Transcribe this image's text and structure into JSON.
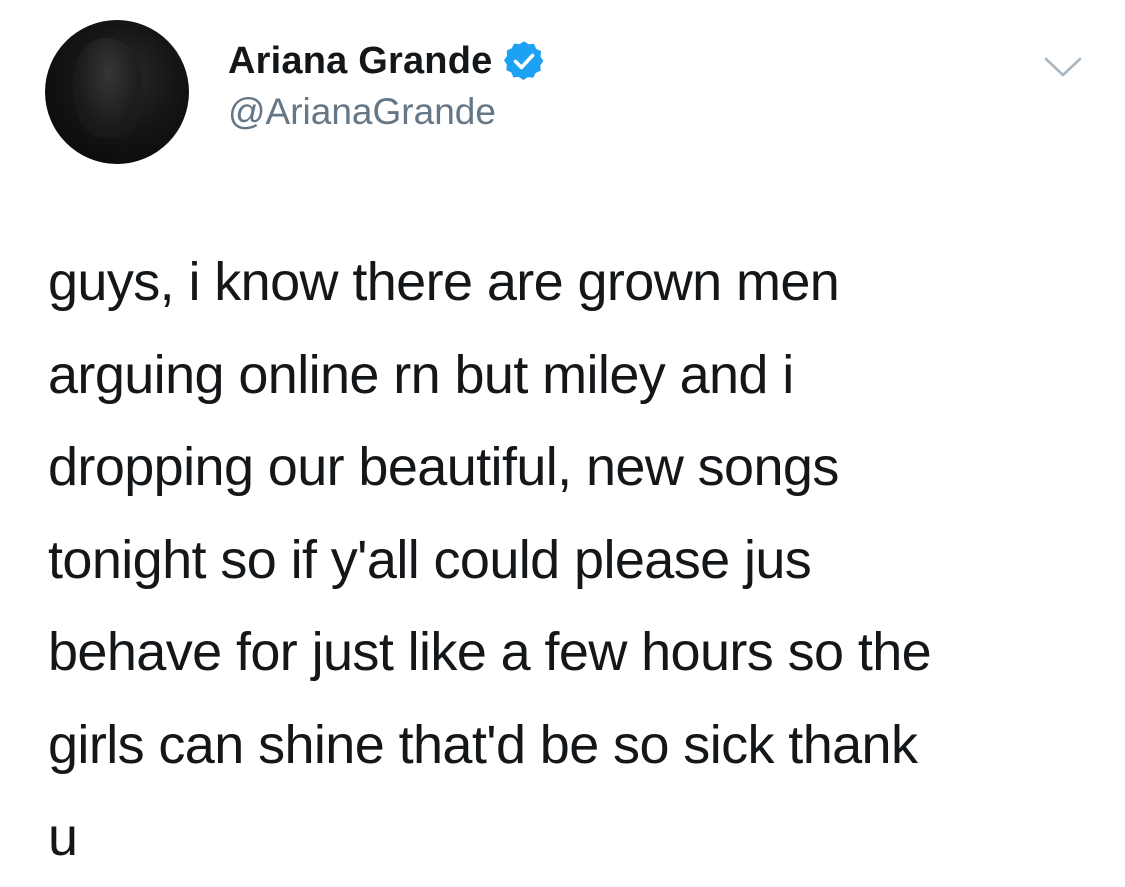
{
  "tweet": {
    "author": {
      "name": "Ariana Grande",
      "handle": "@ArianaGrande",
      "verified": true,
      "verified_icon": "verified-badge-icon"
    },
    "text": "guys, i know there are grown men\narguing online rn but miley and i\ndropping our beautiful, new songs\ntonight so if y'all could please jus\nbehave for just like a few hours so the\ngirls can shine that'd be so sick thank\nu",
    "menu_icon": "chevron-down-icon"
  },
  "colors": {
    "text": "#14171a",
    "secondary": "#657786",
    "verified": "#1da1f2",
    "chevron": "#aab8c2",
    "background": "#ffffff"
  }
}
